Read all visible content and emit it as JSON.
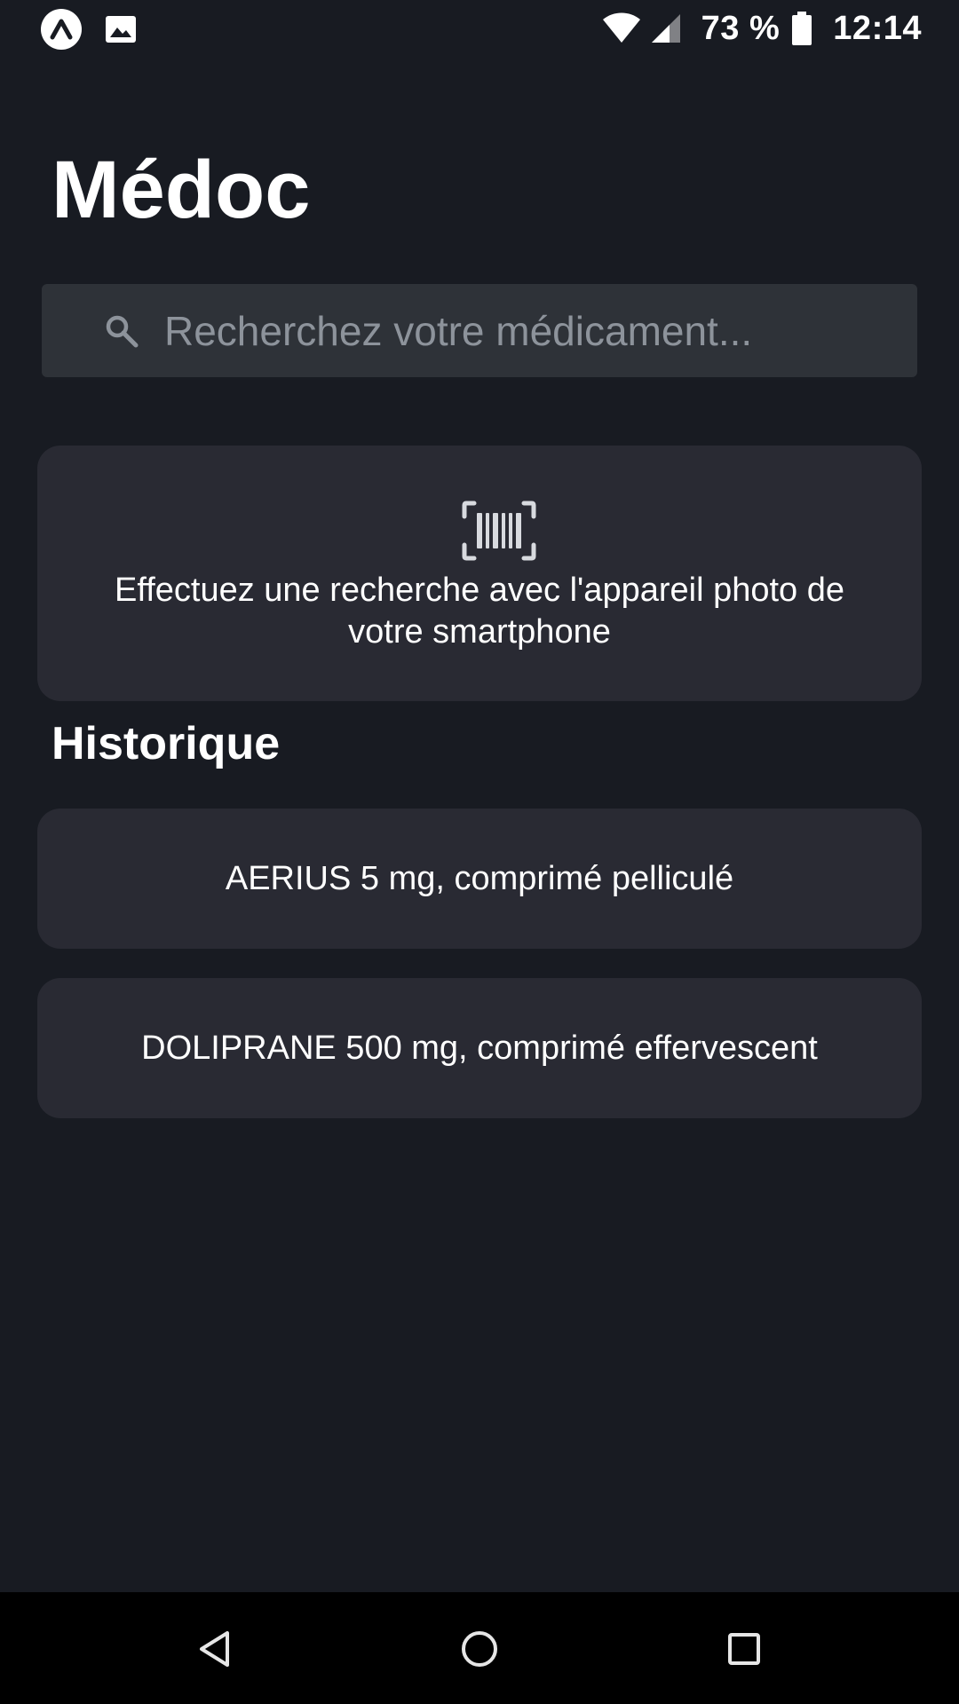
{
  "status_bar": {
    "app_icon": "expo-app-icon",
    "notification_icon": "image-icon",
    "wifi_icon": "wifi-icon",
    "signal_icon": "signal-icon",
    "battery_text": "73 %",
    "battery_icon": "battery-icon",
    "time": "12:14"
  },
  "header": {
    "title": "Médoc"
  },
  "search": {
    "placeholder": "Recherchez votre médicament...",
    "value": "",
    "icon": "search-icon"
  },
  "scan_card": {
    "icon": "barcode-scan-icon",
    "text": "Effectuez une recherche avec l'appareil photo de votre smartphone"
  },
  "history": {
    "title": "Historique",
    "items": [
      {
        "label": "AERIUS 5 mg, comprimé pelliculé"
      },
      {
        "label": "DOLIPRANE 500 mg, comprimé effervescent"
      }
    ]
  },
  "nav_bar": {
    "back_icon": "back-triangle-icon",
    "home_icon": "home-circle-icon",
    "recents_icon": "recents-square-icon"
  },
  "colors": {
    "background": "#181b22",
    "card": "#292a33",
    "search_bg": "#2e3238",
    "text": "#ffffff",
    "placeholder": "#8d939b",
    "nav_bg": "#000000"
  }
}
